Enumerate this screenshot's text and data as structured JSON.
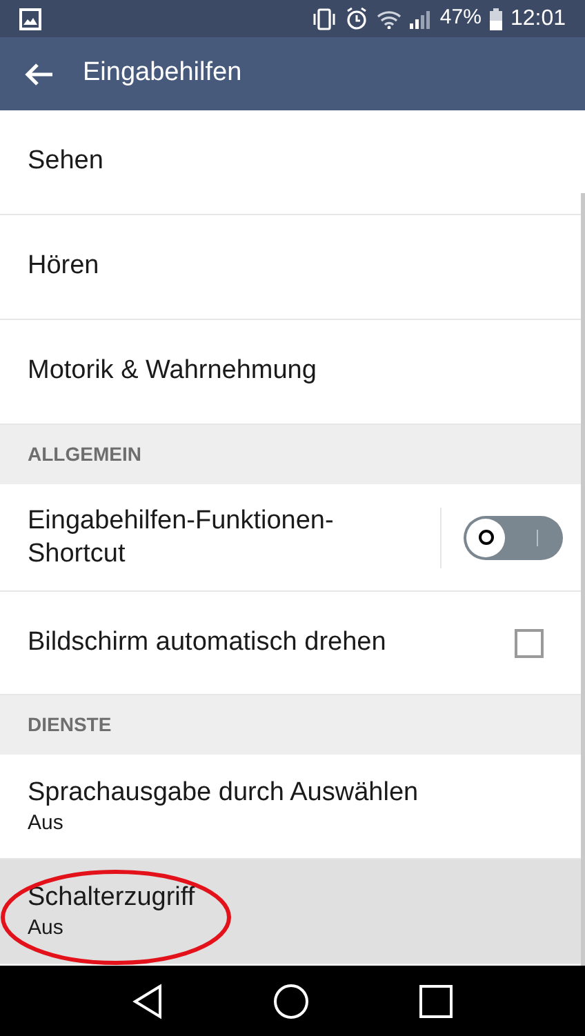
{
  "status_bar": {
    "battery": "47%",
    "time": "12:01"
  },
  "app_bar": {
    "title": "Eingabehilfen"
  },
  "items": [
    {
      "kind": "nav",
      "title": "Sehen"
    },
    {
      "kind": "nav",
      "title": "Hören"
    },
    {
      "kind": "nav",
      "title": "Motorik & Wahrnehmung"
    },
    {
      "kind": "header",
      "title": "ALLGEMEIN"
    },
    {
      "kind": "toggle",
      "title": "Eingabehilfen-Funktionen-Shortcut",
      "on": false
    },
    {
      "kind": "checkbox",
      "title": "Bildschirm automatisch drehen",
      "checked": false
    },
    {
      "kind": "header",
      "title": "DIENSTE"
    },
    {
      "kind": "subtitle",
      "title": "Sprachausgabe durch Auswählen",
      "summary": "Aus",
      "selected": false,
      "circled": false
    },
    {
      "kind": "subtitle",
      "title": "Schalterzugriff",
      "summary": "Aus",
      "selected": true,
      "circled": true
    }
  ]
}
